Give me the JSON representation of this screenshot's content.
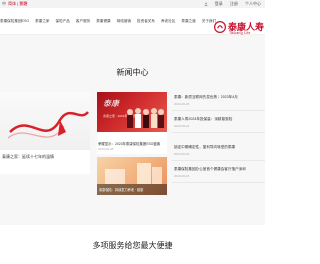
{
  "topbar": {
    "region_text": "中",
    "lang_text": "简体 | 繁體",
    "login": "登录",
    "register": "注册",
    "account": "个人中心"
  },
  "nav": {
    "items": [
      "泰康保险集团ESG",
      "泰康之家",
      "保险产品",
      "客户服务",
      "泰康健康",
      "网络营销",
      "投资者关系",
      "养老社区",
      "泰康之道",
      "关于我们"
    ]
  },
  "logo": {
    "text": "泰康人寿",
    "en": "Taikang Life"
  },
  "news": {
    "title": "新闻中心",
    "card1_caption": "泰康之家：延续十七年的温情",
    "card2_brand": "泰康",
    "card2_mini": "泰康之家 · 2023年度盛典",
    "card2_caption": "荣耀显示：2023年泰康保险集团ESG盛典",
    "card2_date": "2023-06-28",
    "card3_caption": "泰康保险：持续发力养老 · 健康",
    "list": [
      {
        "title": "泰康：新质互联网先发优势｜2023年4月",
        "date": "2023-06-26"
      },
      {
        "title": "泰康人寿2024年投保量：深耕普惠险",
        "date": "2023-06-21"
      },
      {
        "title": "锁定中期确定性，盈利导向转型的泰康",
        "date": "2023-06-20"
      },
      {
        "title": "泰康保险集团办公室首个健康会客厅落户深圳",
        "date": "2023-06-15"
      }
    ]
  },
  "more": {
    "title": "多项服务给您最大便捷"
  },
  "colors": {
    "brand": "#c8102e",
    "section_bg": "#f7f7f7"
  }
}
